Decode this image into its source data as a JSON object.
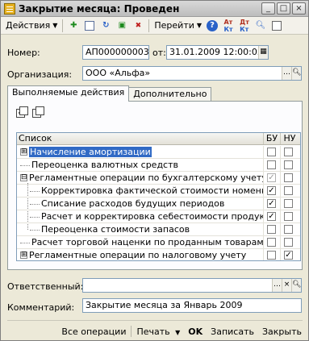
{
  "window": {
    "title": "Закрытие месяца: Проведен",
    "controls": [
      "_",
      "□",
      "×"
    ]
  },
  "toolbar": {
    "actions_label": "Действия",
    "goto_label": "Перейти",
    "kt_label": "Кт",
    "icons": [
      "add-icon",
      "copy-icon",
      "refresh-icon",
      "post-icon",
      "unpost-icon",
      "print-icon",
      "help-icon",
      "dt-kt-icon",
      "dt-kt-icon-2",
      "search-icon",
      "list-icon"
    ]
  },
  "form": {
    "number_label": "Номер:",
    "number_value": "АП000000003",
    "date_label": "от:",
    "date_value": "31.01.2009 12:00:05",
    "org_label": "Организация:",
    "org_value": "ООО «Альфа»"
  },
  "tabs": [
    {
      "label": "Выполняемые действия",
      "active": true
    },
    {
      "label": "Дополнительно",
      "active": false
    }
  ],
  "grid": {
    "headers": {
      "list": "Список",
      "bu": "БУ",
      "nu": "НУ"
    },
    "rows": [
      {
        "label": "Начисление амортизации",
        "level": 0,
        "expander": "⊞",
        "bu": "",
        "nu": "",
        "selected": true
      },
      {
        "label": "Переоценка валютных средств",
        "level": 0,
        "expander": "",
        "bu": "",
        "nu": ""
      },
      {
        "label": "Регламентные операции по бухгалтерскому учету",
        "level": 0,
        "expander": "⊟",
        "bu": "✓",
        "nu": "",
        "bu_grey": true
      },
      {
        "label": "Корректировка фактической стоимости номенкл...",
        "level": 1,
        "expander": "",
        "bu": "✓",
        "nu": ""
      },
      {
        "label": "Списание расходов будущих периодов",
        "level": 1,
        "expander": "",
        "bu": "✓",
        "nu": ""
      },
      {
        "label": "Расчет и корректировка себестоимости продукц...",
        "level": 1,
        "expander": "",
        "bu": "✓",
        "nu": ""
      },
      {
        "label": "Переоценка стоимости запасов",
        "level": 1,
        "expander": "",
        "bu": "",
        "nu": ""
      },
      {
        "label": "Расчет торговой наценки по проданным товарам",
        "level": 0,
        "expander": "",
        "bu": "",
        "nu": ""
      },
      {
        "label": "Регламентные операции по налоговому учету",
        "level": 0,
        "expander": "⊞",
        "bu": "",
        "nu": "✓"
      }
    ]
  },
  "footer": {
    "responsible_label": "Ответственный:",
    "responsible_value": "",
    "comment_label": "Комментарий:",
    "comment_value": "Закрытие месяца за Январь 2009"
  },
  "buttons": {
    "all_operations": "Все операции",
    "print": "Печать",
    "ok": "OK",
    "save": "Записать",
    "close": "Закрыть"
  }
}
